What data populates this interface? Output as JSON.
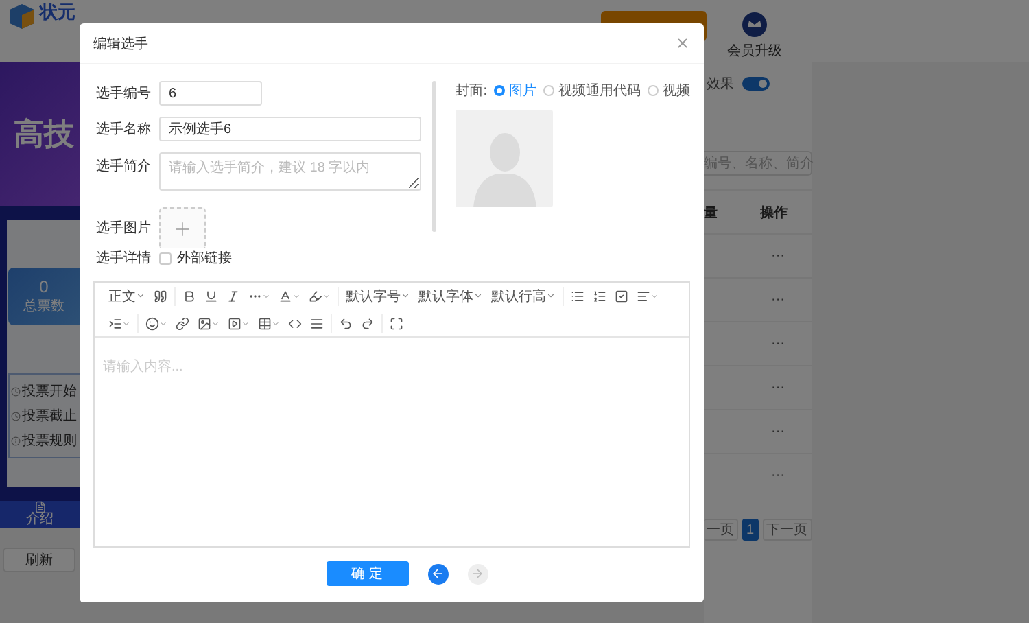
{
  "background": {
    "brand": "状元",
    "vip_label": "会员升级",
    "banner_text": "高技",
    "stat": {
      "value": "0",
      "label": "总票数"
    },
    "info": [
      "投票开始",
      "投票截止",
      "投票规则"
    ],
    "nav_tab": "介绍",
    "refresh_button": "刷新",
    "toggle": {
      "label": "效果",
      "on": true
    },
    "search": {
      "placeholder": "编号、名称、简介"
    },
    "columns": [
      "量",
      "操作"
    ],
    "rows": [
      "···",
      "···",
      "···",
      "···",
      "···",
      "···"
    ],
    "pagination": {
      "prev": "一页",
      "pages": [
        {
          "label": "1",
          "selected": true
        }
      ],
      "next": "下一页"
    }
  },
  "dialog": {
    "title": "编辑选手",
    "fields": [
      {
        "kind": "input",
        "label": "选手编号",
        "value": "6"
      },
      {
        "kind": "input",
        "label": "选手名称",
        "value": "示例选手6"
      },
      {
        "kind": "textarea",
        "label": "选手简介",
        "placeholder": "请输入选手简介，建议 18 字以内"
      },
      {
        "kind": "upload",
        "label": "选手图片"
      },
      {
        "kind": "checkbox",
        "label": "选手详情",
        "option": "外部链接",
        "checked": false
      }
    ],
    "cover": {
      "label": "封面:",
      "options": [
        {
          "label": "图片",
          "selected": true
        },
        {
          "label": "视频通用代码",
          "selected": false
        },
        {
          "label": "视频",
          "selected": false
        }
      ]
    },
    "editor": {
      "toolbar_menus": [
        "正文",
        "默认字号",
        "默认字体",
        "默认行高"
      ],
      "placeholder": "请输入内容..."
    },
    "confirm_button": "确 定",
    "pager_arrows": [
      {
        "disabled": false
      },
      {
        "disabled": true
      }
    ]
  }
}
